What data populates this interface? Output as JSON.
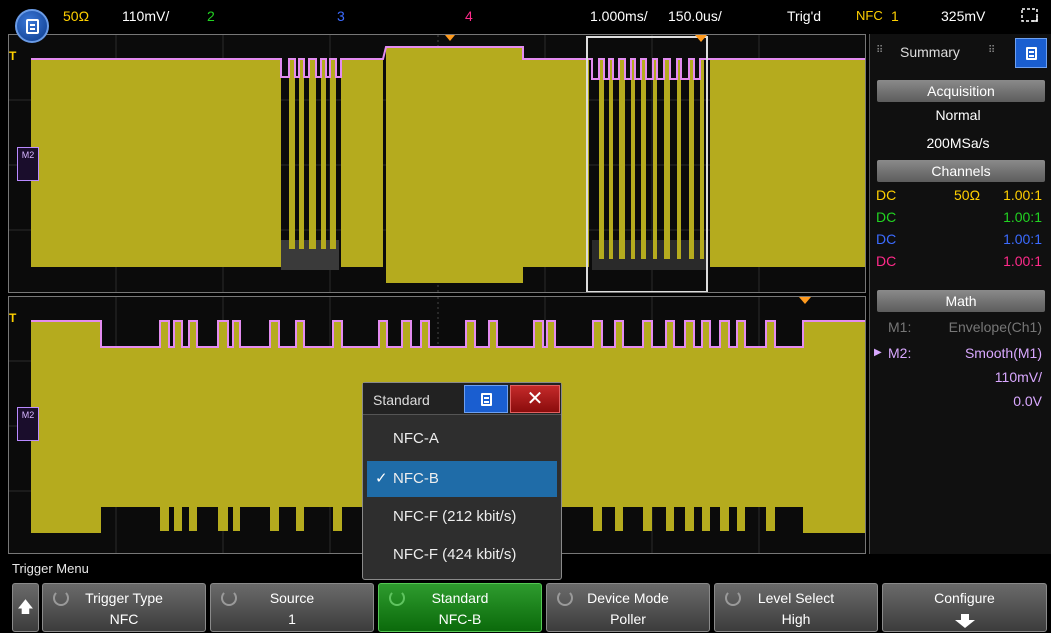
{
  "status": {
    "ch1_impedance": "50Ω",
    "ch1_scale": "110mV/",
    "ch2_label": "2",
    "ch3_label": "3",
    "ch4_label": "4",
    "timebase": "1.000ms/",
    "zoom_timebase": "150.0us/",
    "trigger_state": "Trig'd",
    "trigger_mode": "NFC",
    "trigger_source": "1",
    "trigger_level": "325mV"
  },
  "markers": {
    "trigger": "T",
    "math2": "M2"
  },
  "side_panel": {
    "title": "Summary",
    "acquisition_header": "Acquisition",
    "acq_mode": "Normal",
    "sample_rate": "200MSa/s",
    "channels_header": "Channels",
    "channels": [
      {
        "coupling": "DC",
        "impedance": "50Ω",
        "probe": "1.00:1",
        "color": "#ffd000"
      },
      {
        "coupling": "DC",
        "impedance": "",
        "probe": "1.00:1",
        "color": "#22d322"
      },
      {
        "coupling": "DC",
        "impedance": "",
        "probe": "1.00:1",
        "color": "#3b6bff"
      },
      {
        "coupling": "DC",
        "impedance": "",
        "probe": "1.00:1",
        "color": "#ff2a8a"
      }
    ],
    "math_header": "Math",
    "m1_label": "M1:",
    "m1_value": "Envelope(Ch1)",
    "m2_label": "M2:",
    "m2_value": "Smooth(M1)",
    "m2_scale": "110mV/",
    "m2_offset": "0.0V"
  },
  "trigger_menu": {
    "title": "Trigger Menu",
    "softkeys": [
      {
        "label": "Trigger Type",
        "value": "NFC"
      },
      {
        "label": "Source",
        "value": "1"
      },
      {
        "label": "Standard",
        "value": "NFC-B"
      },
      {
        "label": "Device Mode",
        "value": "Poller"
      },
      {
        "label": "Level Select",
        "value": "High"
      },
      {
        "label": "Configure",
        "value": ""
      }
    ]
  },
  "standard_dialog": {
    "title": "Standard",
    "options": [
      "NFC-A",
      "NFC-B",
      "NFC-F (212 kbit/s)",
      "NFC-F (424 kbit/s)"
    ],
    "selected": "NFC-B"
  },
  "colors": {
    "ch1": "#ffd000",
    "math_trace": "#e38cf0",
    "waveform_fill": "#b5ab1e",
    "selected_option": "#1f6ca8",
    "active_softkey": "#1b8a1b"
  }
}
